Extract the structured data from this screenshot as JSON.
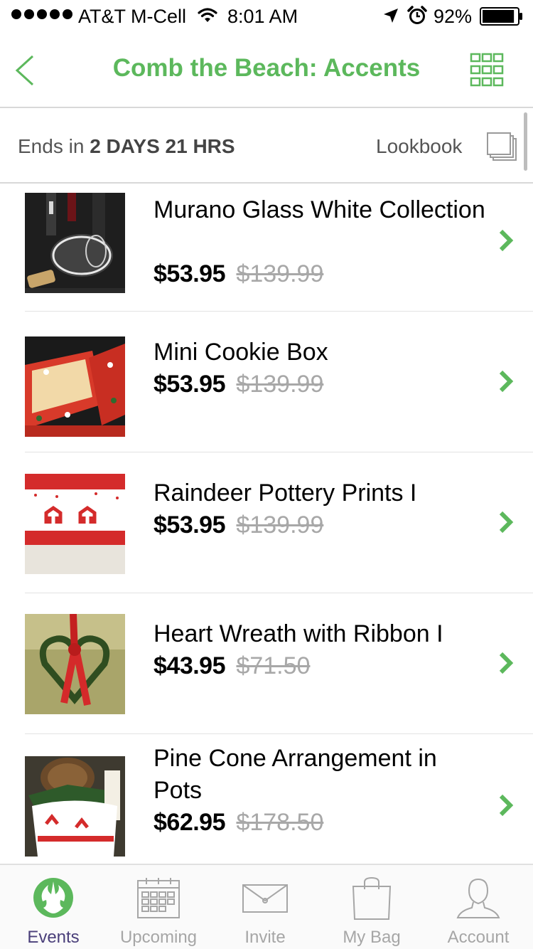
{
  "status_bar": {
    "carrier": "AT&T M-Cell",
    "time": "8:01 AM",
    "battery": "92%",
    "battery_level": 0.92,
    "icons": [
      "signal-icon",
      "wifi-icon",
      "location-icon",
      "alarm-icon",
      "battery-icon"
    ]
  },
  "nav": {
    "title": "Comb the Beach: Accents",
    "back_icon": "chevron-left-icon",
    "grid_icon": "grid-view-icon"
  },
  "event": {
    "ends_prefix": "Ends in",
    "ends_value": "2 DAYS 21 HRS",
    "lookbook_label": "Lookbook",
    "lookbook_icon": "lookbook-icon"
  },
  "products": [
    {
      "name": "Murano Glass White Collection",
      "price": "$53.95",
      "old_price": "$139.99"
    },
    {
      "name": "Mini Cookie Box",
      "price": "$53.95",
      "old_price": "$139.99"
    },
    {
      "name": "Raindeer Pottery Prints I",
      "price": "$53.95",
      "old_price": "$139.99"
    },
    {
      "name": "Heart Wreath with Ribbon I",
      "price": "$43.95",
      "old_price": "$71.50"
    },
    {
      "name": "Pine Cone Arrangement in Pots",
      "price": "$62.95",
      "old_price": "$178.50"
    }
  ],
  "tabs": [
    {
      "label": "Events",
      "icon": "rebel-emblem-icon",
      "active": true
    },
    {
      "label": "Upcoming",
      "icon": "calendar-icon",
      "active": false
    },
    {
      "label": "Invite",
      "icon": "envelope-icon",
      "active": false
    },
    {
      "label": "My Bag",
      "icon": "shopping-bag-icon",
      "active": false
    },
    {
      "label": "Account",
      "icon": "account-icon",
      "active": false
    }
  ],
  "colors": {
    "accent": "#5cb85c",
    "active_tab_label": "#4a3f7a",
    "inactive": "#a6a6a6",
    "old_price": "#a8a8a8"
  }
}
